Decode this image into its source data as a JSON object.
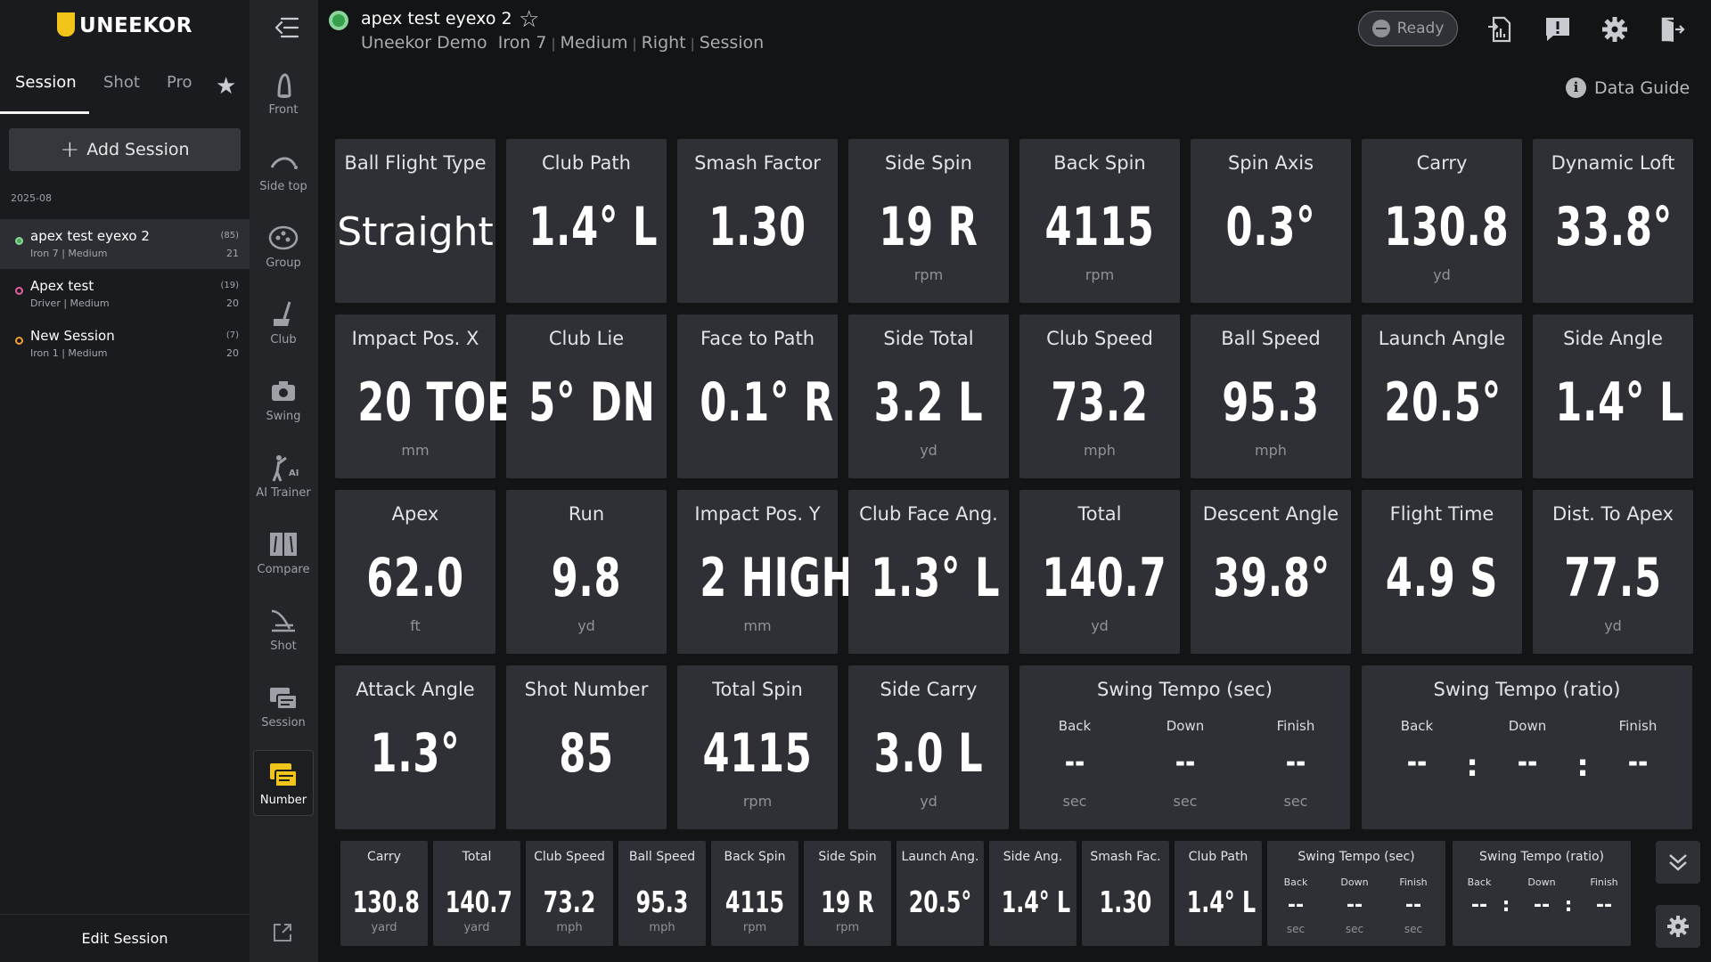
{
  "brand": {
    "name": "UNEEKOR"
  },
  "sidebar": {
    "tabs": [
      {
        "label": "Session"
      },
      {
        "label": "Shot"
      },
      {
        "label": "Pro"
      }
    ],
    "add_session_label": "Add Session",
    "date_group": "2025-08",
    "sessions": [
      {
        "name": "apex test eyexo 2",
        "sub": "Iron 7 | Medium",
        "count": "(85)",
        "number": "21",
        "dot_color": "#4caf50"
      },
      {
        "name": "Apex test",
        "sub": "Driver | Medium",
        "count": "(19)",
        "number": "20",
        "dot_color": "#e05fa0"
      },
      {
        "name": "New Session",
        "sub": "Iron 1 | Medium",
        "count": "(7)",
        "number": "20",
        "dot_color": "#f0a030"
      }
    ],
    "edit_session_label": "Edit Session"
  },
  "rail": {
    "items": [
      {
        "label": "Front",
        "icon": "front-icon"
      },
      {
        "label": "Side top",
        "icon": "side-top-icon"
      },
      {
        "label": "Group",
        "icon": "group-icon"
      },
      {
        "label": "Club",
        "icon": "club-icon"
      },
      {
        "label": "Swing",
        "icon": "camera-icon"
      },
      {
        "label": "AI Trainer",
        "icon": "ai-trainer-icon"
      },
      {
        "label": "Compare",
        "icon": "compare-icon"
      },
      {
        "label": "Shot",
        "icon": "shot-icon"
      },
      {
        "label": "Session",
        "icon": "session-icon"
      },
      {
        "label": "Number",
        "icon": "number-icon"
      }
    ],
    "ai_badge": "AI"
  },
  "header": {
    "title": "apex test eyexo 2",
    "sub": [
      "Uneekor Demo",
      "Iron 7",
      "Medium",
      "Right",
      "Session"
    ],
    "ready_label": "Ready",
    "data_guide_label": "Data Guide",
    "info_glyph": "i"
  },
  "metrics": [
    {
      "title": "Ball Flight Type",
      "value": "Straight",
      "unit": ""
    },
    {
      "title": "Club Path",
      "value": "1.4° L",
      "unit": ""
    },
    {
      "title": "Smash Factor",
      "value": "1.30",
      "unit": ""
    },
    {
      "title": "Side Spin",
      "value": "19 R",
      "unit": "rpm"
    },
    {
      "title": "Back Spin",
      "value": "4115",
      "unit": "rpm"
    },
    {
      "title": "Spin Axis",
      "value": "0.3°",
      "unit": ""
    },
    {
      "title": "Carry",
      "value": "130.8",
      "unit": "yd"
    },
    {
      "title": "Dynamic Loft",
      "value": "33.8°",
      "unit": ""
    },
    {
      "title": "Impact Pos. X",
      "value": "20 TOE",
      "unit": "mm"
    },
    {
      "title": "Club Lie",
      "value": "5° DN",
      "unit": ""
    },
    {
      "title": "Face to Path",
      "value": "0.1° R",
      "unit": ""
    },
    {
      "title": "Side Total",
      "value": "3.2 L",
      "unit": "yd"
    },
    {
      "title": "Club Speed",
      "value": "73.2",
      "unit": "mph"
    },
    {
      "title": "Ball Speed",
      "value": "95.3",
      "unit": "mph"
    },
    {
      "title": "Launch Angle",
      "value": "20.5°",
      "unit": ""
    },
    {
      "title": "Side Angle",
      "value": "1.4° L",
      "unit": ""
    },
    {
      "title": "Apex",
      "value": "62.0",
      "unit": "ft"
    },
    {
      "title": "Run",
      "value": "9.8",
      "unit": "yd"
    },
    {
      "title": "Impact Pos. Y",
      "value": "2 HIGH",
      "unit": "mm"
    },
    {
      "title": "Club Face Ang.",
      "value": "1.3° L",
      "unit": ""
    },
    {
      "title": "Total",
      "value": "140.7",
      "unit": "yd"
    },
    {
      "title": "Descent Angle",
      "value": "39.8°",
      "unit": ""
    },
    {
      "title": "Flight Time",
      "value": "4.9 S",
      "unit": ""
    },
    {
      "title": "Dist. To Apex",
      "value": "77.5",
      "unit": "yd"
    },
    {
      "title": "Attack Angle",
      "value": "1.3°",
      "unit": ""
    },
    {
      "title": "Shot Number",
      "value": "85",
      "unit": ""
    },
    {
      "title": "Total Spin",
      "value": "4115",
      "unit": "rpm"
    },
    {
      "title": "Side Carry",
      "value": "3.0 L",
      "unit": "yd"
    }
  ],
  "tempo_sec": {
    "title": "Swing Tempo (sec)",
    "labels": [
      "Back",
      "Down",
      "Finish"
    ],
    "values": [
      "--",
      "--",
      "--"
    ],
    "unit": "sec"
  },
  "tempo_ratio": {
    "title": "Swing Tempo (ratio)",
    "labels": [
      "Back",
      "Down",
      "Finish"
    ],
    "values": [
      "--",
      "--",
      "--"
    ],
    "sep": ":"
  },
  "strip": [
    {
      "title": "Carry",
      "value": "130.8",
      "unit": "yard"
    },
    {
      "title": "Total",
      "value": "140.7",
      "unit": "yard"
    },
    {
      "title": "Club Speed",
      "value": "73.2",
      "unit": "mph"
    },
    {
      "title": "Ball Speed",
      "value": "95.3",
      "unit": "mph"
    },
    {
      "title": "Back Spin",
      "value": "4115",
      "unit": "rpm"
    },
    {
      "title": "Side Spin",
      "value": "19 R",
      "unit": "rpm"
    },
    {
      "title": "Launch Ang.",
      "value": "20.5°",
      "unit": ""
    },
    {
      "title": "Side Ang.",
      "value": "1.4° L",
      "unit": ""
    },
    {
      "title": "Smash Fac.",
      "value": "1.30",
      "unit": ""
    },
    {
      "title": "Club Path",
      "value": "1.4° L",
      "unit": ""
    }
  ],
  "colors": {
    "accent": "#f0c419",
    "card_bg": "#2f3035",
    "ready_dot": "#37a04d"
  }
}
